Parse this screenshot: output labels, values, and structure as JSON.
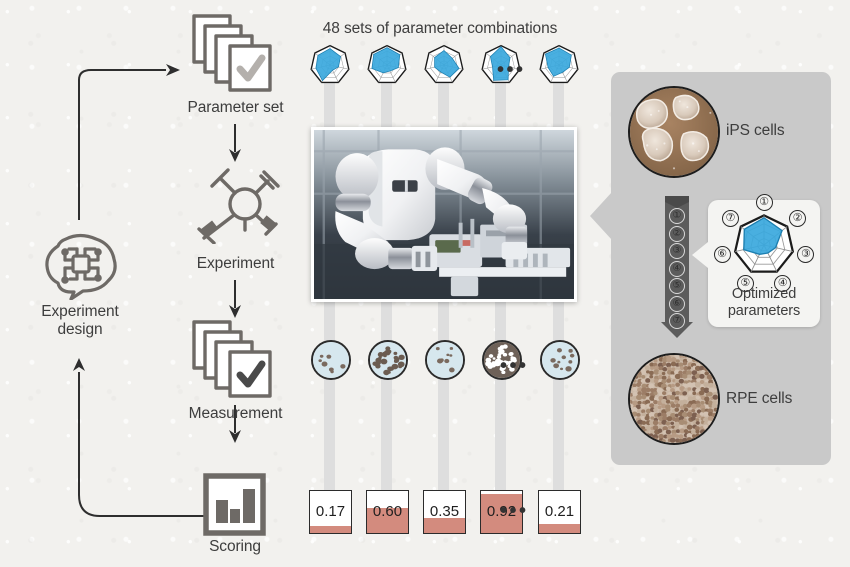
{
  "figure": {
    "background_color": "#f2f1ee",
    "accent_blue": "#3aa8dd",
    "accent_salmon": "#d38b7e",
    "panel_gray": "#c9c9c9"
  },
  "cycle": {
    "steps": [
      {
        "id": "experiment-design",
        "label": "Experiment\ndesign",
        "icon": "ai-brain-icon"
      },
      {
        "id": "parameter-set",
        "label": "Parameter set",
        "icon": "document-stack-check-icon"
      },
      {
        "id": "experiment",
        "label": "Experiment",
        "icon": "pipette-robot-icon"
      },
      {
        "id": "measurement",
        "label": "Measurement",
        "icon": "document-stack-check-icon"
      },
      {
        "id": "scoring",
        "label": "Scoring",
        "icon": "bar-chart-icon"
      }
    ]
  },
  "parameters": {
    "heading": "48 sets of parameter combinations",
    "count": 48,
    "axes": 7,
    "ellipsis": "•••",
    "radars": [
      {
        "index": 1,
        "values": [
          0.85,
          0.7,
          0.45,
          0.3,
          0.9,
          0.75,
          0.8
        ]
      },
      {
        "index": 2,
        "values": [
          0.9,
          0.85,
          0.6,
          0.35,
          0.45,
          0.8,
          0.88
        ]
      },
      {
        "index": 3,
        "values": [
          0.75,
          0.55,
          0.8,
          0.7,
          0.4,
          0.5,
          0.62
        ]
      },
      {
        "index": 4,
        "values": [
          0.95,
          0.6,
          0.4,
          0.85,
          0.88,
          0.45,
          0.7
        ]
      },
      {
        "index": 5,
        "values": [
          0.88,
          0.82,
          0.55,
          0.42,
          0.65,
          0.58,
          0.9
        ]
      }
    ]
  },
  "measurement_dishes": [
    {
      "index": 1,
      "density": "low",
      "medium_color": "#d6e7ee",
      "cell_color": "#7a6a5f",
      "cell_count": 7
    },
    {
      "index": 2,
      "density": "high",
      "medium_color": "#d6e7ee",
      "cell_color": "#6b5c51",
      "cell_count": 26
    },
    {
      "index": 3,
      "density": "low",
      "medium_color": "#d6e7ee",
      "cell_color": "#7a6a5f",
      "cell_count": 9
    },
    {
      "index": 4,
      "density": "very-high",
      "medium_color": "#6e6158",
      "cell_color": "#ffffff",
      "cell_count": 34
    },
    {
      "index": 5,
      "density": "low",
      "medium_color": "#d6e7ee",
      "cell_color": "#7a6a5f",
      "cell_count": 10
    }
  ],
  "scores": {
    "values": [
      "0.17",
      "0.60",
      "0.35",
      "0.92",
      "0.21"
    ],
    "fills": [
      0.17,
      0.6,
      0.35,
      0.92,
      0.21
    ],
    "ellipsis": "•••"
  },
  "robot": {
    "caption": "",
    "alt": "dual-arm white laboratory automation robot"
  },
  "results_panel": {
    "input": {
      "label": "iPS cells",
      "image": "ips-cell-colony-micrograph"
    },
    "output": {
      "label": "RPE cells",
      "image": "rpe-cell-monolayer-micrograph"
    },
    "process_steps": [
      "①",
      "②",
      "③",
      "④",
      "⑤",
      "⑥",
      "⑦"
    ],
    "optimized": {
      "label": "Optimized\nparameters",
      "axis_labels": [
        "①",
        "②",
        "③",
        "④",
        "⑤",
        "⑥",
        "⑦"
      ],
      "values": [
        0.92,
        0.78,
        0.4,
        0.3,
        0.35,
        0.7,
        0.85
      ]
    }
  }
}
